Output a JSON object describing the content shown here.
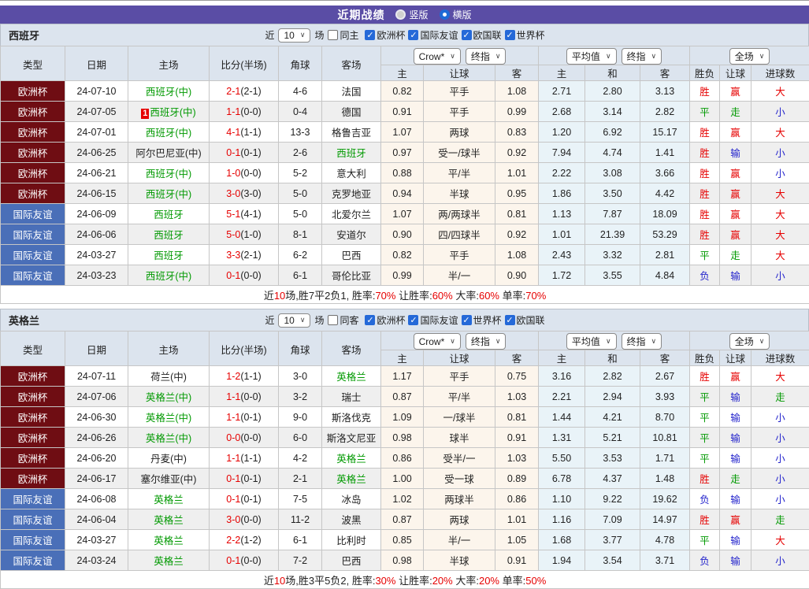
{
  "title_bar": {
    "title": "近期战绩",
    "vertical_label": "竖版",
    "horizontal_label": "横版"
  },
  "header": {
    "cols": [
      "类型",
      "日期",
      "主场",
      "比分(半场)",
      "角球",
      "客场"
    ],
    "sub": [
      "主",
      "让球",
      "客",
      "主",
      "和",
      "客",
      "胜负",
      "让球",
      "进球数"
    ],
    "crow_select": "Crow*",
    "crow_index_select": "终指",
    "avg_select": "平均值",
    "avg_index_select": "终指",
    "scope_select": "全场"
  },
  "sections": [
    {
      "team": "西班牙",
      "filter": {
        "near_label": "近",
        "count": "10",
        "games_label": "场",
        "same_label": "同主",
        "same_checked": false,
        "leagues": [
          "欧洲杯",
          "国际友谊",
          "欧国联",
          "世界杯"
        ]
      },
      "rows": [
        {
          "type": "欧洲杯",
          "typeCls": "type-cup",
          "date": "24-07-10",
          "badge": "",
          "home": "西班牙(中)",
          "homeCls": "tm-green",
          "score": "2-1",
          "half": "(2-1)",
          "corner": "4-6",
          "away": "法国",
          "awayCls": "",
          "h": "0.82",
          "hc": "平手",
          "a": "1.08",
          "m1": "2.71",
          "m2": "2.80",
          "m3": "3.13",
          "r1": "胜",
          "r1c": "res-r",
          "r2": "赢",
          "r2c": "res-r",
          "r3": "大",
          "r3c": "res-r"
        },
        {
          "type": "欧洲杯",
          "typeCls": "type-cup",
          "date": "24-07-05",
          "badge": "1",
          "home": "西班牙(中)",
          "homeCls": "tm-green",
          "score": "1-1",
          "half": "(0-0)",
          "corner": "0-4",
          "away": "德国",
          "awayCls": "",
          "h": "0.91",
          "hc": "平手",
          "a": "0.99",
          "m1": "2.68",
          "m2": "3.14",
          "m3": "2.82",
          "r1": "平",
          "r1c": "res-g",
          "r2": "走",
          "r2c": "res-g",
          "r3": "小",
          "r3c": "res-b"
        },
        {
          "type": "欧洲杯",
          "typeCls": "type-cup",
          "date": "24-07-01",
          "badge": "",
          "home": "西班牙(中)",
          "homeCls": "tm-green",
          "score": "4-1",
          "half": "(1-1)",
          "corner": "13-3",
          "away": "格鲁吉亚",
          "awayCls": "",
          "h": "1.07",
          "hc": "两球",
          "a": "0.83",
          "m1": "1.20",
          "m2": "6.92",
          "m3": "15.17",
          "r1": "胜",
          "r1c": "res-r",
          "r2": "赢",
          "r2c": "res-r",
          "r3": "大",
          "r3c": "res-r"
        },
        {
          "type": "欧洲杯",
          "typeCls": "type-cup",
          "date": "24-06-25",
          "badge": "",
          "home": "阿尔巴尼亚(中)",
          "homeCls": "",
          "score": "0-1",
          "half": "(0-1)",
          "corner": "2-6",
          "away": "西班牙",
          "awayCls": "tm-green",
          "h": "0.97",
          "hc": "受一/球半",
          "a": "0.92",
          "m1": "7.94",
          "m2": "4.74",
          "m3": "1.41",
          "r1": "胜",
          "r1c": "res-r",
          "r2": "输",
          "r2c": "res-b",
          "r3": "小",
          "r3c": "res-b"
        },
        {
          "type": "欧洲杯",
          "typeCls": "type-cup",
          "date": "24-06-21",
          "badge": "",
          "home": "西班牙(中)",
          "homeCls": "tm-green",
          "score": "1-0",
          "half": "(0-0)",
          "corner": "5-2",
          "away": "意大利",
          "awayCls": "",
          "h": "0.88",
          "hc": "平/半",
          "a": "1.01",
          "m1": "2.22",
          "m2": "3.08",
          "m3": "3.66",
          "r1": "胜",
          "r1c": "res-r",
          "r2": "赢",
          "r2c": "res-r",
          "r3": "小",
          "r3c": "res-b"
        },
        {
          "type": "欧洲杯",
          "typeCls": "type-cup",
          "date": "24-06-15",
          "badge": "",
          "home": "西班牙(中)",
          "homeCls": "tm-green",
          "score": "3-0",
          "half": "(3-0)",
          "corner": "5-0",
          "away": "克罗地亚",
          "awayCls": "",
          "h": "0.94",
          "hc": "半球",
          "a": "0.95",
          "m1": "1.86",
          "m2": "3.50",
          "m3": "4.42",
          "r1": "胜",
          "r1c": "res-r",
          "r2": "赢",
          "r2c": "res-r",
          "r3": "大",
          "r3c": "res-r"
        },
        {
          "type": "国际友谊",
          "typeCls": "type-fr",
          "date": "24-06-09",
          "badge": "",
          "home": "西班牙",
          "homeCls": "tm-green",
          "score": "5-1",
          "half": "(4-1)",
          "corner": "5-0",
          "away": "北爱尔兰",
          "awayCls": "",
          "h": "1.07",
          "hc": "两/两球半",
          "a": "0.81",
          "m1": "1.13",
          "m2": "7.87",
          "m3": "18.09",
          "r1": "胜",
          "r1c": "res-r",
          "r2": "赢",
          "r2c": "res-r",
          "r3": "大",
          "r3c": "res-r"
        },
        {
          "type": "国际友谊",
          "typeCls": "type-fr",
          "date": "24-06-06",
          "badge": "",
          "home": "西班牙",
          "homeCls": "tm-green",
          "score": "5-0",
          "half": "(1-0)",
          "corner": "8-1",
          "away": "安道尔",
          "awayCls": "",
          "h": "0.90",
          "hc": "四/四球半",
          "a": "0.92",
          "m1": "1.01",
          "m2": "21.39",
          "m3": "53.29",
          "r1": "胜",
          "r1c": "res-r",
          "r2": "赢",
          "r2c": "res-r",
          "r3": "大",
          "r3c": "res-r"
        },
        {
          "type": "国际友谊",
          "typeCls": "type-fr",
          "date": "24-03-27",
          "badge": "",
          "home": "西班牙",
          "homeCls": "tm-green",
          "score": "3-3",
          "half": "(2-1)",
          "corner": "6-2",
          "away": "巴西",
          "awayCls": "",
          "h": "0.82",
          "hc": "平手",
          "a": "1.08",
          "m1": "2.43",
          "m2": "3.32",
          "m3": "2.81",
          "r1": "平",
          "r1c": "res-g",
          "r2": "走",
          "r2c": "res-g",
          "r3": "大",
          "r3c": "res-r"
        },
        {
          "type": "国际友谊",
          "typeCls": "type-fr",
          "date": "24-03-23",
          "badge": "",
          "home": "西班牙(中)",
          "homeCls": "tm-green",
          "score": "0-1",
          "half": "(0-0)",
          "corner": "6-1",
          "away": "哥伦比亚",
          "awayCls": "",
          "h": "0.99",
          "hc": "半/一",
          "a": "0.90",
          "m1": "1.72",
          "m2": "3.55",
          "m3": "4.84",
          "r1": "负",
          "r1c": "res-b",
          "r2": "输",
          "r2c": "res-b",
          "r3": "小",
          "r3c": "res-b"
        }
      ],
      "summary": [
        {
          "t": "近"
        },
        {
          "t": "10",
          "red": true
        },
        {
          "t": "场,胜7平2负1, 胜率:"
        },
        {
          "t": "70%",
          "red": true
        },
        {
          "t": " 让胜率:"
        },
        {
          "t": "60%",
          "red": true
        },
        {
          "t": " 大率:"
        },
        {
          "t": "60%",
          "red": true
        },
        {
          "t": " 单率:"
        },
        {
          "t": "70%",
          "red": true
        }
      ]
    },
    {
      "team": "英格兰",
      "filter": {
        "near_label": "近",
        "count": "10",
        "games_label": "场",
        "same_label": "同客",
        "same_checked": false,
        "leagues": [
          "欧洲杯",
          "国际友谊",
          "世界杯",
          "欧国联"
        ]
      },
      "rows": [
        {
          "type": "欧洲杯",
          "typeCls": "type-cup",
          "date": "24-07-11",
          "badge": "",
          "home": "荷兰(中)",
          "homeCls": "",
          "score": "1-2",
          "half": "(1-1)",
          "corner": "3-0",
          "away": "英格兰",
          "awayCls": "tm-green",
          "h": "1.17",
          "hc": "平手",
          "a": "0.75",
          "m1": "3.16",
          "m2": "2.82",
          "m3": "2.67",
          "r1": "胜",
          "r1c": "res-r",
          "r2": "赢",
          "r2c": "res-r",
          "r3": "大",
          "r3c": "res-r"
        },
        {
          "type": "欧洲杯",
          "typeCls": "type-cup",
          "date": "24-07-06",
          "badge": "",
          "home": "英格兰(中)",
          "homeCls": "tm-green",
          "score": "1-1",
          "half": "(0-0)",
          "corner": "3-2",
          "away": "瑞士",
          "awayCls": "",
          "h": "0.87",
          "hc": "平/半",
          "a": "1.03",
          "m1": "2.21",
          "m2": "2.94",
          "m3": "3.93",
          "r1": "平",
          "r1c": "res-g",
          "r2": "输",
          "r2c": "res-b",
          "r3": "走",
          "r3c": "res-g"
        },
        {
          "type": "欧洲杯",
          "typeCls": "type-cup",
          "date": "24-06-30",
          "badge": "",
          "home": "英格兰(中)",
          "homeCls": "tm-green",
          "score": "1-1",
          "half": "(0-1)",
          "corner": "9-0",
          "away": "斯洛伐克",
          "awayCls": "",
          "h": "1.09",
          "hc": "一/球半",
          "a": "0.81",
          "m1": "1.44",
          "m2": "4.21",
          "m3": "8.70",
          "r1": "平",
          "r1c": "res-g",
          "r2": "输",
          "r2c": "res-b",
          "r3": "小",
          "r3c": "res-b"
        },
        {
          "type": "欧洲杯",
          "typeCls": "type-cup",
          "date": "24-06-26",
          "badge": "",
          "home": "英格兰(中)",
          "homeCls": "tm-green",
          "score": "0-0",
          "half": "(0-0)",
          "corner": "6-0",
          "away": "斯洛文尼亚",
          "awayCls": "",
          "h": "0.98",
          "hc": "球半",
          "a": "0.91",
          "m1": "1.31",
          "m2": "5.21",
          "m3": "10.81",
          "r1": "平",
          "r1c": "res-g",
          "r2": "输",
          "r2c": "res-b",
          "r3": "小",
          "r3c": "res-b"
        },
        {
          "type": "欧洲杯",
          "typeCls": "type-cup",
          "date": "24-06-20",
          "badge": "",
          "home": "丹麦(中)",
          "homeCls": "",
          "score": "1-1",
          "half": "(1-1)",
          "corner": "4-2",
          "away": "英格兰",
          "awayCls": "tm-green",
          "h": "0.86",
          "hc": "受半/一",
          "a": "1.03",
          "m1": "5.50",
          "m2": "3.53",
          "m3": "1.71",
          "r1": "平",
          "r1c": "res-g",
          "r2": "输",
          "r2c": "res-b",
          "r3": "小",
          "r3c": "res-b"
        },
        {
          "type": "欧洲杯",
          "typeCls": "type-cup",
          "date": "24-06-17",
          "badge": "",
          "home": "塞尔维亚(中)",
          "homeCls": "",
          "score": "0-1",
          "half": "(0-1)",
          "corner": "2-1",
          "away": "英格兰",
          "awayCls": "tm-green",
          "h": "1.00",
          "hc": "受一球",
          "a": "0.89",
          "m1": "6.78",
          "m2": "4.37",
          "m3": "1.48",
          "r1": "胜",
          "r1c": "res-r",
          "r2": "走",
          "r2c": "res-g",
          "r3": "小",
          "r3c": "res-b"
        },
        {
          "type": "国际友谊",
          "typeCls": "type-fr",
          "date": "24-06-08",
          "badge": "",
          "home": "英格兰",
          "homeCls": "tm-green",
          "score": "0-1",
          "half": "(0-1)",
          "corner": "7-5",
          "away": "冰岛",
          "awayCls": "",
          "h": "1.02",
          "hc": "两球半",
          "a": "0.86",
          "m1": "1.10",
          "m2": "9.22",
          "m3": "19.62",
          "r1": "负",
          "r1c": "res-b",
          "r2": "输",
          "r2c": "res-b",
          "r3": "小",
          "r3c": "res-b"
        },
        {
          "type": "国际友谊",
          "typeCls": "type-fr",
          "date": "24-06-04",
          "badge": "",
          "home": "英格兰",
          "homeCls": "tm-green",
          "score": "3-0",
          "half": "(0-0)",
          "corner": "11-2",
          "away": "波黑",
          "awayCls": "",
          "h": "0.87",
          "hc": "两球",
          "a": "1.01",
          "m1": "1.16",
          "m2": "7.09",
          "m3": "14.97",
          "r1": "胜",
          "r1c": "res-r",
          "r2": "赢",
          "r2c": "res-r",
          "r3": "走",
          "r3c": "res-g"
        },
        {
          "type": "国际友谊",
          "typeCls": "type-fr",
          "date": "24-03-27",
          "badge": "",
          "home": "英格兰",
          "homeCls": "tm-green",
          "score": "2-2",
          "half": "(1-2)",
          "corner": "6-1",
          "away": "比利时",
          "awayCls": "",
          "h": "0.85",
          "hc": "半/一",
          "a": "1.05",
          "m1": "1.68",
          "m2": "3.77",
          "m3": "4.78",
          "r1": "平",
          "r1c": "res-g",
          "r2": "输",
          "r2c": "res-b",
          "r3": "大",
          "r3c": "res-r"
        },
        {
          "type": "国际友谊",
          "typeCls": "type-fr",
          "date": "24-03-24",
          "badge": "",
          "home": "英格兰",
          "homeCls": "tm-green",
          "score": "0-1",
          "half": "(0-0)",
          "corner": "7-2",
          "away": "巴西",
          "awayCls": "",
          "h": "0.98",
          "hc": "半球",
          "a": "0.91",
          "m1": "1.94",
          "m2": "3.54",
          "m3": "3.71",
          "r1": "负",
          "r1c": "res-b",
          "r2": "输",
          "r2c": "res-b",
          "r3": "小",
          "r3c": "res-b"
        }
      ],
      "summary": [
        {
          "t": "近"
        },
        {
          "t": "10",
          "red": true
        },
        {
          "t": "场,胜3平5负2, 胜率:"
        },
        {
          "t": "30%",
          "red": true
        },
        {
          "t": " 让胜率:"
        },
        {
          "t": "20%",
          "red": true
        },
        {
          "t": " 大率:"
        },
        {
          "t": "20%",
          "red": true
        },
        {
          "t": " 单率:"
        },
        {
          "t": "50%",
          "red": true
        }
      ]
    }
  ]
}
